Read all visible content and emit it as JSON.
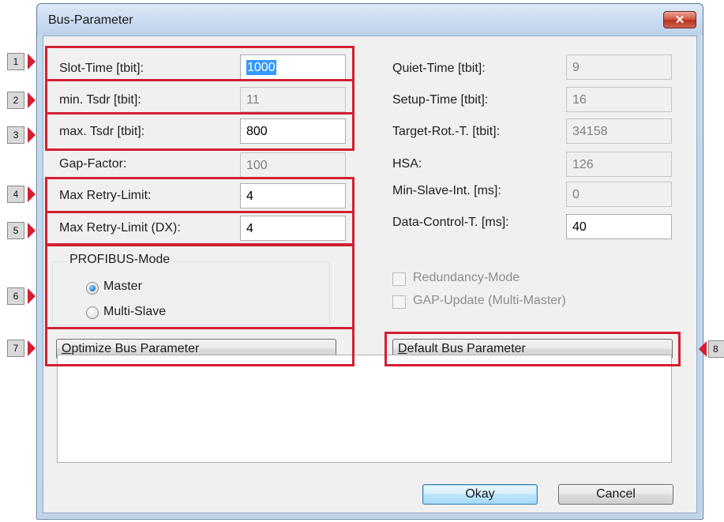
{
  "window": {
    "title": "Bus-Parameter",
    "close_glyph": "✕"
  },
  "left_fields": [
    {
      "label": "Slot-Time [tbit]:",
      "value": "1000",
      "readonly": false,
      "selected": true
    },
    {
      "label": "min. Tsdr [tbit]:",
      "value": "11",
      "readonly": true
    },
    {
      "label": "max. Tsdr [tbit]:",
      "value": "800",
      "readonly": false
    },
    {
      "label": "Gap-Factor:",
      "value": "100",
      "readonly": true
    },
    {
      "label": "Max Retry-Limit:",
      "value": "4",
      "readonly": false
    },
    {
      "label": "Max Retry-Limit (DX):",
      "value": "4",
      "readonly": false
    }
  ],
  "right_fields": [
    {
      "label": "Quiet-Time [tbit]:",
      "value": "9",
      "readonly": true
    },
    {
      "label": "Setup-Time [tbit]:",
      "value": "16",
      "readonly": true
    },
    {
      "label": "Target-Rot.-T. [tbit]:",
      "value": "34158",
      "readonly": true
    },
    {
      "label": "HSA:",
      "value": "126",
      "readonly": true
    },
    {
      "label": "Min-Slave-Int. [ms]:",
      "value": "0",
      "readonly": true
    },
    {
      "label": "Data-Control-T. [ms]:",
      "value": "40",
      "readonly": false
    }
  ],
  "profibus_mode": {
    "title": "PROFIBUS-Mode",
    "options": [
      "Master",
      "Multi-Slave"
    ],
    "selected": "Master"
  },
  "checkboxes": [
    {
      "label": "Redundancy-Mode",
      "checked": false,
      "disabled": true
    },
    {
      "label": "GAP-Update (Multi-Master)",
      "checked": false,
      "disabled": true
    }
  ],
  "buttons": {
    "optimize_first": "O",
    "optimize_rest": "ptimize Bus Parameter",
    "default_first": "D",
    "default_rest": "efault Bus Parameter",
    "okay": "Okay",
    "cancel": "Cancel"
  },
  "annotation_markers": [
    "1",
    "2",
    "3",
    "4",
    "5",
    "6",
    "7",
    "8"
  ],
  "colors": {
    "highlight": "#d21f33",
    "marker_bg": "#d9d9d9",
    "selection": "#3399ff"
  }
}
